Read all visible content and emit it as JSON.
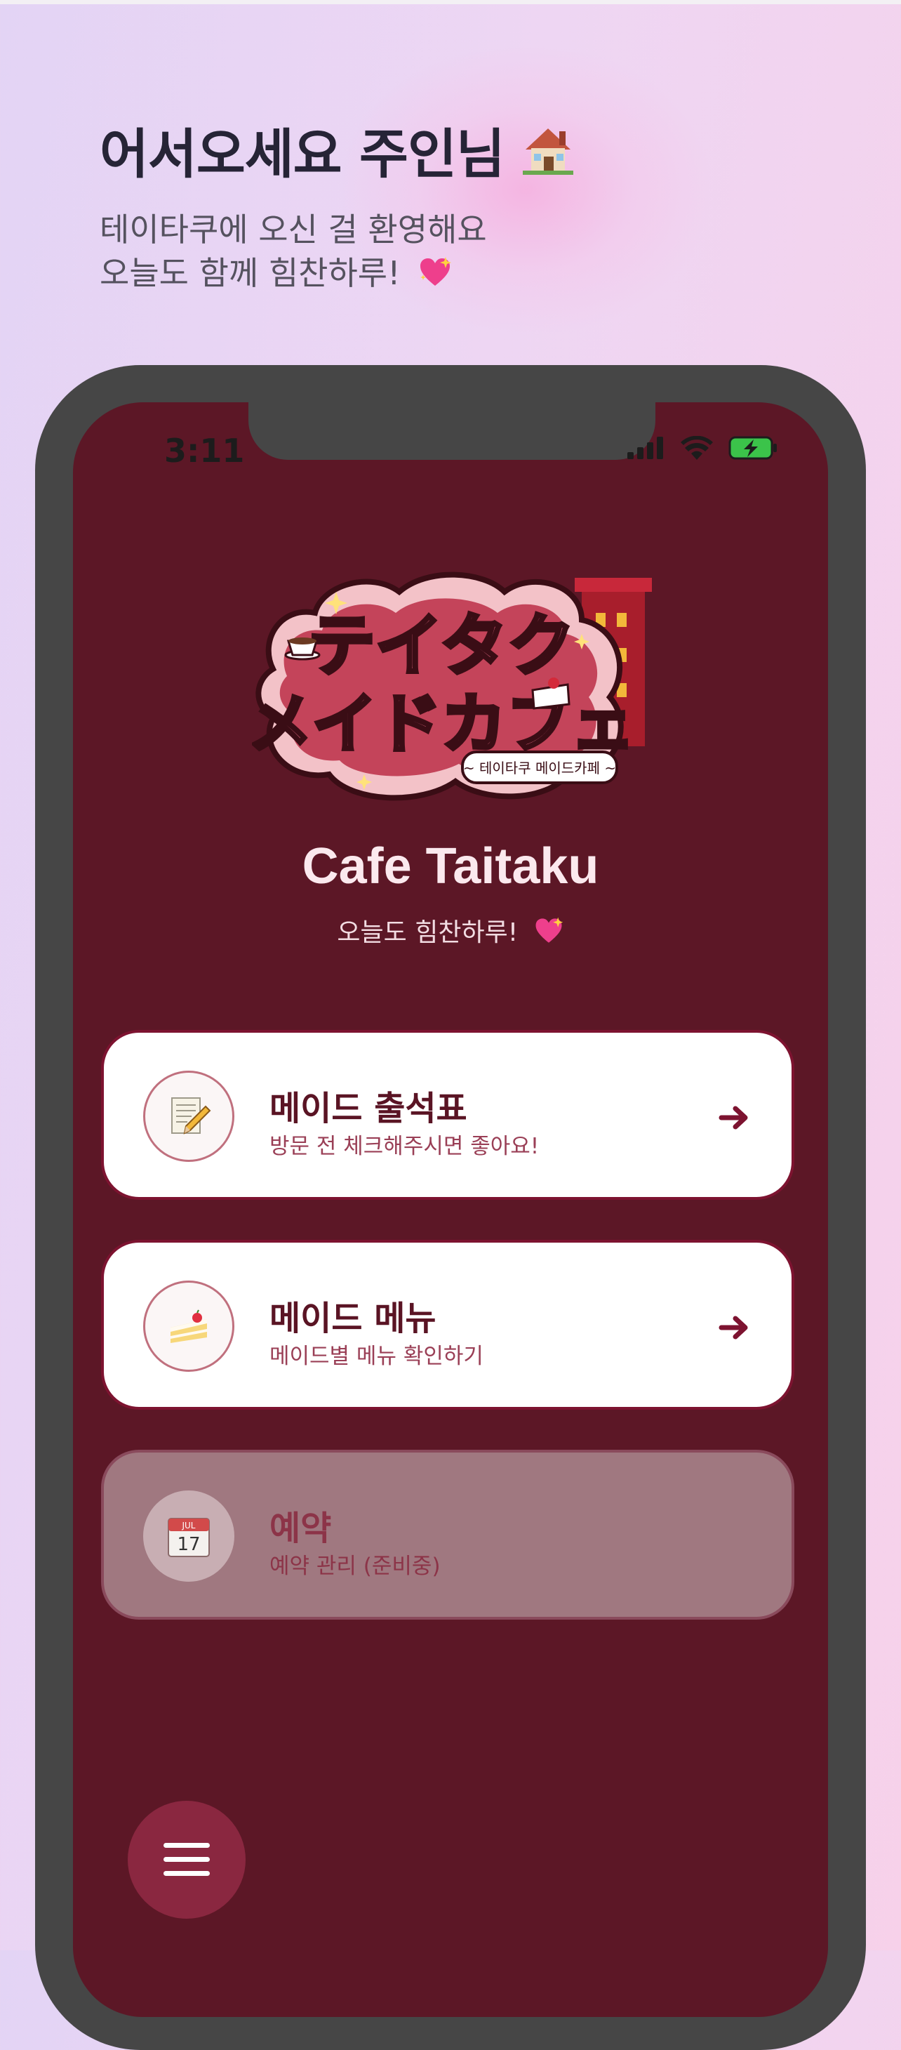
{
  "welcome": {
    "title": "어서오세요 주인님",
    "title_icon": "house-icon",
    "line1": "테이타쿠에 오신 걸 환영해요",
    "line2": "오늘도 함께 힘찬하루!",
    "line2_icon": "sparkling-heart-icon"
  },
  "status_bar": {
    "time": "3:11",
    "icons": [
      "signal-icon",
      "wifi-icon",
      "battery-charging-icon"
    ]
  },
  "logo": {
    "main_text": "テイタク メイドカフェ",
    "sub_text": "~ 테이타쿠 메이드카페 ~"
  },
  "cafe": {
    "title": "Cafe Taitaku",
    "subtitle": "오늘도 힘찬하루!",
    "subtitle_icon": "sparkling-heart-icon"
  },
  "cards": [
    {
      "title": "메이드 출석표",
      "desc": "방문 전 체크해주시면 좋아요!",
      "icon": "memo-icon",
      "enabled": true
    },
    {
      "title": "메이드 메뉴",
      "desc": "메이드별 메뉴 확인하기",
      "icon": "cake-icon",
      "enabled": true
    },
    {
      "title": "예약",
      "desc": "예약 관리 (준비중)",
      "icon": "calendar-icon",
      "enabled": false,
      "calendar_month": "JUL",
      "calendar_day": "17"
    }
  ],
  "fab": {
    "icon": "hamburger-menu-icon"
  },
  "colors": {
    "screen_bg": "#5c1726",
    "accent": "#7d1330",
    "fab": "#8a2740",
    "frame": "#464646"
  }
}
